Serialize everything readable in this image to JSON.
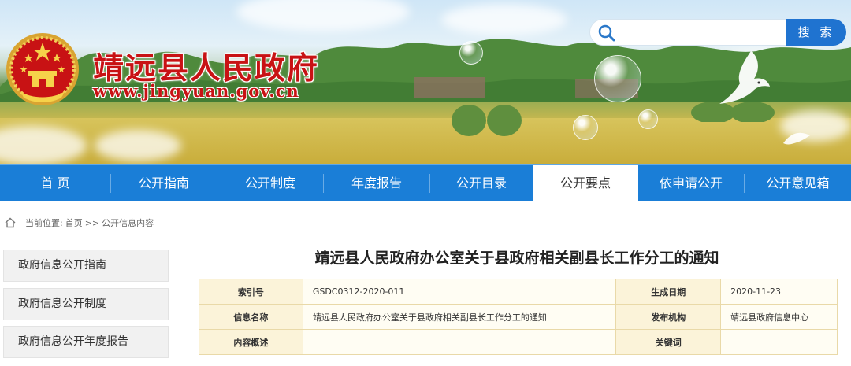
{
  "header": {
    "site_title": "靖远县人民政府",
    "site_url": "www.jingyuan.gov.cn",
    "search": {
      "placeholder": "",
      "button_label": "搜 索"
    }
  },
  "nav": {
    "items": [
      {
        "label": "首 页"
      },
      {
        "label": "公开指南"
      },
      {
        "label": "公开制度"
      },
      {
        "label": "年度报告"
      },
      {
        "label": "公开目录"
      },
      {
        "label": "公开要点",
        "active": true
      },
      {
        "label": "依申请公开"
      },
      {
        "label": "公开意见箱"
      }
    ]
  },
  "breadcrumb": {
    "prefix": "当前位置:",
    "home": "首页",
    "separator": ">>",
    "current": "公开信息内容"
  },
  "sidebar": {
    "items": [
      {
        "label": "政府信息公开指南"
      },
      {
        "label": "政府信息公开制度"
      },
      {
        "label": "政府信息公开年度报告"
      }
    ]
  },
  "document": {
    "title": "靖远县人民政府办公室关于县政府相关副县长工作分工的通知",
    "meta": {
      "index_label": "索引号",
      "index_value": "GSDC0312-2020-011",
      "date_label": "生成日期",
      "date_value": "2020-11-23",
      "name_label": "信息名称",
      "name_value": "靖远县人民政府办公室关于县政府相关副县长工作分工的通知",
      "publisher_label": "发布机构",
      "publisher_value": "靖远县政府信息中心",
      "summary_label": "内容概述",
      "summary_value": "",
      "keywords_label": "关键词",
      "keywords_value": ""
    }
  },
  "colors": {
    "title_red": "#c81214",
    "nav_blue": "#1a7ed7",
    "search_blue": "#1f73d0",
    "table_border": "#e9d9a8"
  },
  "icons": [
    "national-emblem-icon",
    "search-icon",
    "home-icon",
    "dove-icon"
  ]
}
